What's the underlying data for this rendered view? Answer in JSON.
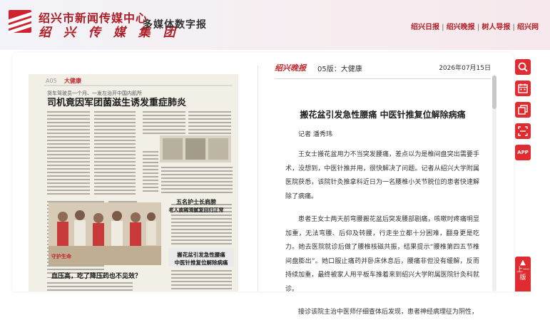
{
  "header": {
    "org_name": "绍兴市新闻传媒中心",
    "group_name": "绍 兴 传 媒 集 团",
    "site_name": "多媒体数字报",
    "nav": [
      "绍兴日报",
      "绍兴晚报",
      "树人导报",
      "绍兴网"
    ]
  },
  "newspaper_page": {
    "page_label": "A05",
    "section_label": "大健康",
    "headlines": [
      "货车驾驶员一个月、一发左治开中国内肌所",
      "司机竟因军团菌滋生诱发重症肺炎",
      "五名护士长肩膀",
      "老人痰稀滑腻复回归正常",
      "守护生命",
      "血压高，吃了降压药也不见效？",
      "搬花盆引发急性腰痛",
      "中医针推复位解除病痛"
    ]
  },
  "article": {
    "paper_logo": "绍兴晚报",
    "edition": "05版：大健康",
    "date": "2026年07月15日",
    "title": "搬花盆引发急性腰痛 中医针推复位解除病痛",
    "author": "记者 潘秀玮",
    "paragraphs": [
      "王女士搬花盆用力不当突发腰痛，差点以为是椎间盘突出需要手术，没想到，中医针推并用，很快解决了问题。记者从绍兴大学附属医院获悉，该院针灸推拿科近日为一名腰椎小关节脱位的患者快速解除了病痛。",
      "患者王女士两天前弯腰搬花盆后突发腰部剧痛，咳嗽时疼痛明显加重，无法弯腰、后仰及转腰，行走坐立都十分困难，翻身更是吃力。她去医院就诊后做了腰椎核磁共振，结果提示“腰椎第四五节椎间盘膨出”。她口服止痛药并卧床休息后，腰痛非但没有缓解，反而持续加重，最终被家人用平板车推着来到绍兴大学附属医院针灸科就诊。",
      "接诊该院主治中医师仔细查体后发现，患者神经病理征为阴性，"
    ]
  },
  "sidebar": {
    "app_label": "APP",
    "prev_label": "上一版",
    "prev_arrow": "▲"
  },
  "colors": {
    "brand_red": "#b01e25",
    "button_red": "#e02b30"
  }
}
